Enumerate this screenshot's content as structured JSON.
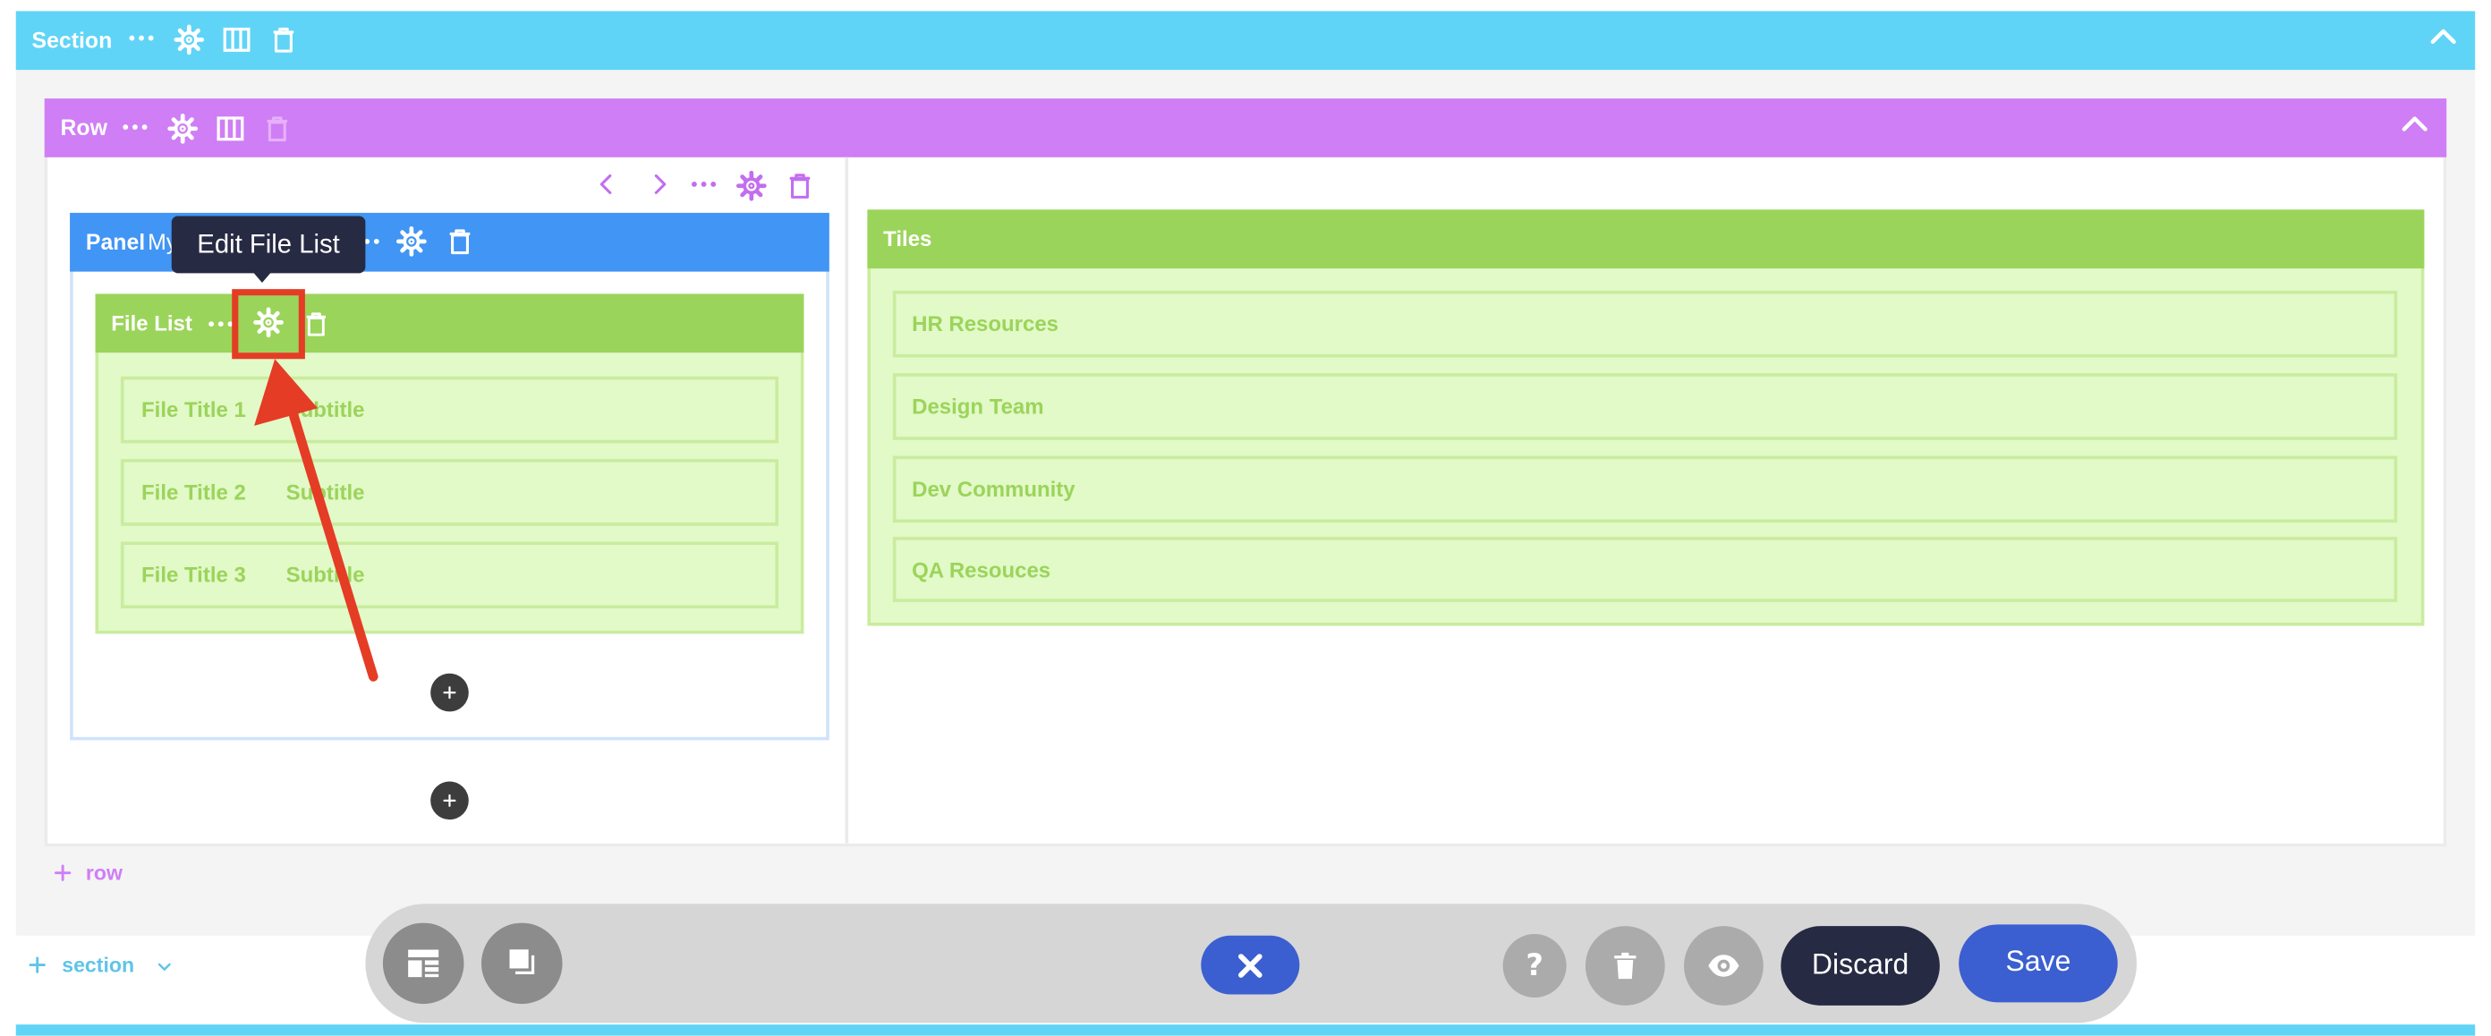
{
  "section": {
    "label": "Section",
    "add_label": "section"
  },
  "row": {
    "label": "Row",
    "add_label": "row"
  },
  "panel": {
    "label": "Panel",
    "subtitle_fragment": "My",
    "tooltip": "Edit File List"
  },
  "file_list": {
    "label": "File List",
    "items": [
      {
        "title": "File Title 1",
        "subtitle": "Subtitle"
      },
      {
        "title": "File Title 2",
        "subtitle": "Subtitle"
      },
      {
        "title": "File Title 3",
        "subtitle": "Subtitle"
      }
    ]
  },
  "tiles": {
    "label": "Tiles",
    "items": [
      "HR Resources",
      "Design Team",
      "Dev Community",
      "QA Resouces"
    ]
  },
  "toolbar": {
    "discard_label": "Discard",
    "save_label": "Save"
  },
  "colors": {
    "section": "#5fd4f7",
    "row": "#cf7ef5",
    "panel": "#4195f4",
    "green": "#9bd45a",
    "green_light": "#e2f9c8",
    "dark": "#272a43",
    "save": "#3b5fd0",
    "annotation": "#e53c25"
  },
  "icons": [
    "dots-icon",
    "gear-icon",
    "columns-icon",
    "trash-icon",
    "chevron-up-icon",
    "chevron-left-icon",
    "chevron-right-icon",
    "plus-icon",
    "layout-icon",
    "layers-icon",
    "close-icon",
    "help-icon",
    "eye-icon",
    "chevron-down-icon"
  ]
}
